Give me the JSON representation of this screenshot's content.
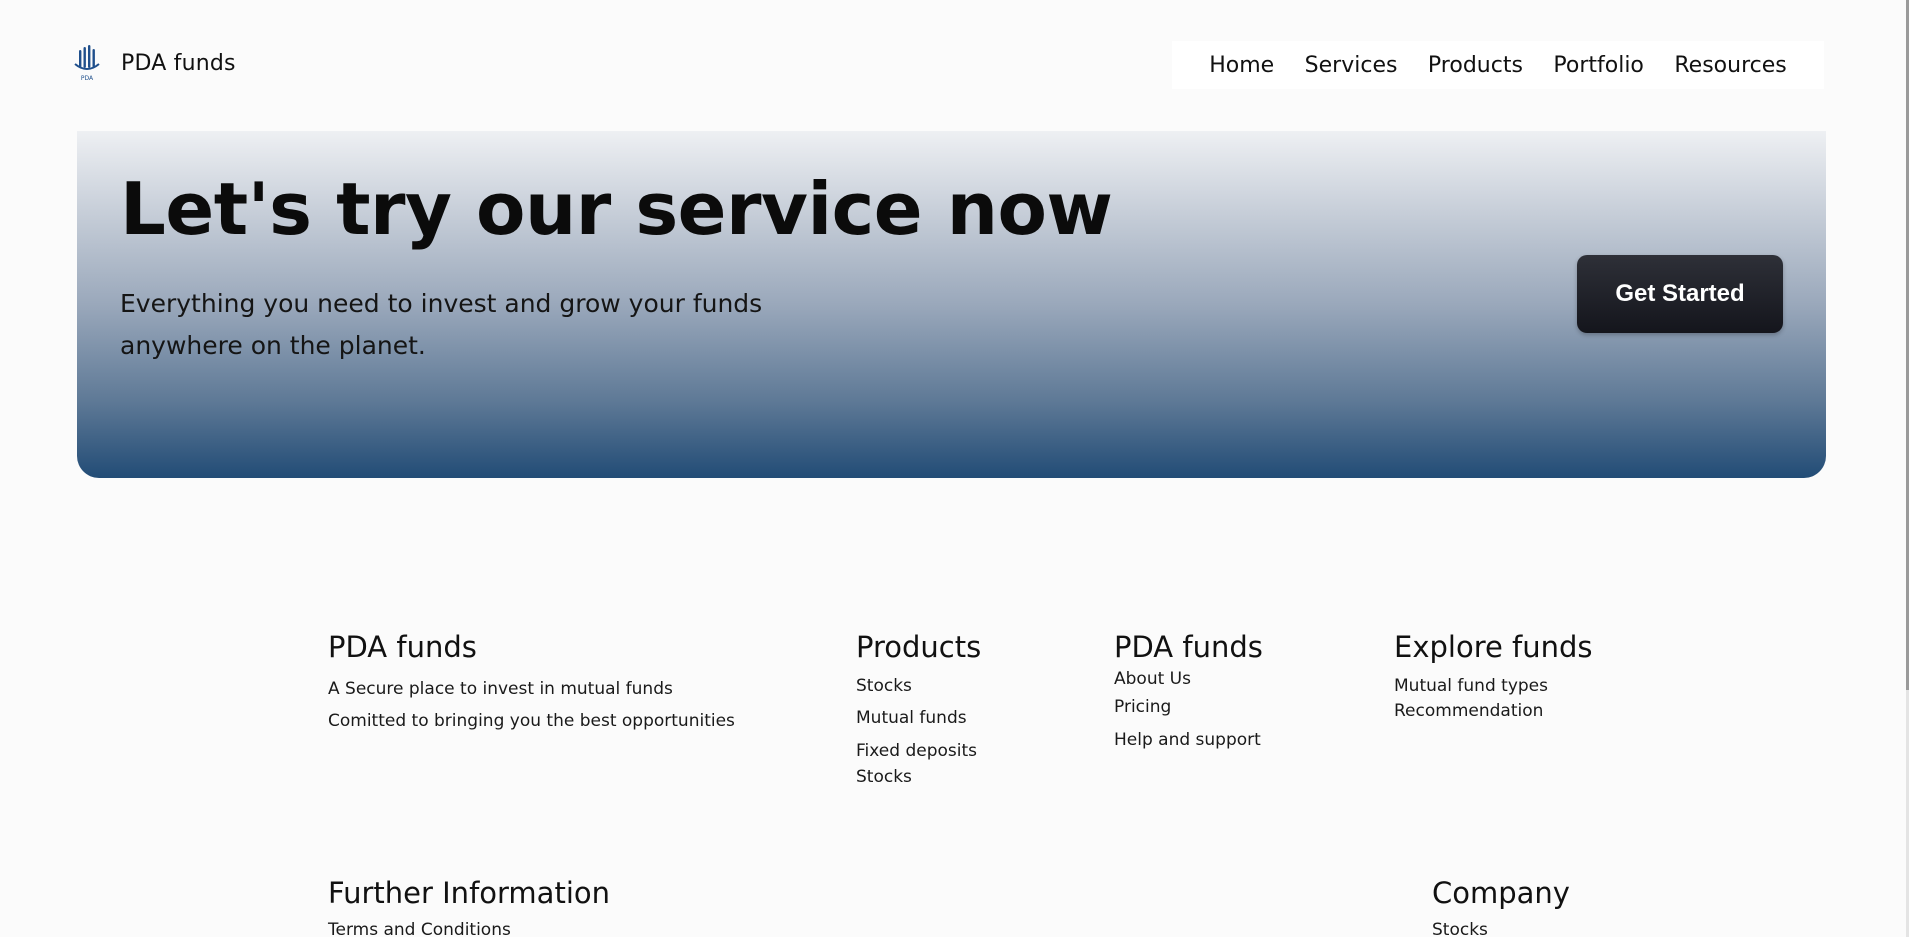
{
  "header": {
    "brand_name": "PDA funds",
    "logo_text": "PDA",
    "nav": [
      "Home",
      "Services",
      "Products",
      "Portfolio",
      "Resources"
    ]
  },
  "hero": {
    "title": "Let's try our service now",
    "subtitle_line1": "Everything you need to invest and grow your funds",
    "subtitle_line2": "anywhere on the planet.",
    "cta_label": "Get Started"
  },
  "footer": {
    "about": {
      "heading": "PDA funds",
      "lines": [
        "A Secure place to invest in mutual funds",
        "Comitted to bringing you the best opportunities"
      ]
    },
    "products": {
      "heading": "Products",
      "links": [
        "Stocks",
        "Mutual funds",
        "Fixed deposits",
        "Stocks"
      ]
    },
    "company_links": {
      "heading": "PDA funds",
      "links": [
        "About Us",
        "Pricing",
        "Help and support"
      ]
    },
    "explore": {
      "heading": "Explore funds",
      "links": [
        "Mutual fund types",
        "Recommendation"
      ]
    },
    "further": {
      "heading": "Further Information",
      "links": [
        "Terms and Conditions"
      ]
    },
    "company": {
      "heading": "Company",
      "links": [
        "Stocks"
      ]
    }
  },
  "colors": {
    "hero_top": "#eef0f3",
    "hero_bottom": "#224c76",
    "cta_bg": "#1e1f27",
    "logo_blue": "#1f4f8c"
  }
}
